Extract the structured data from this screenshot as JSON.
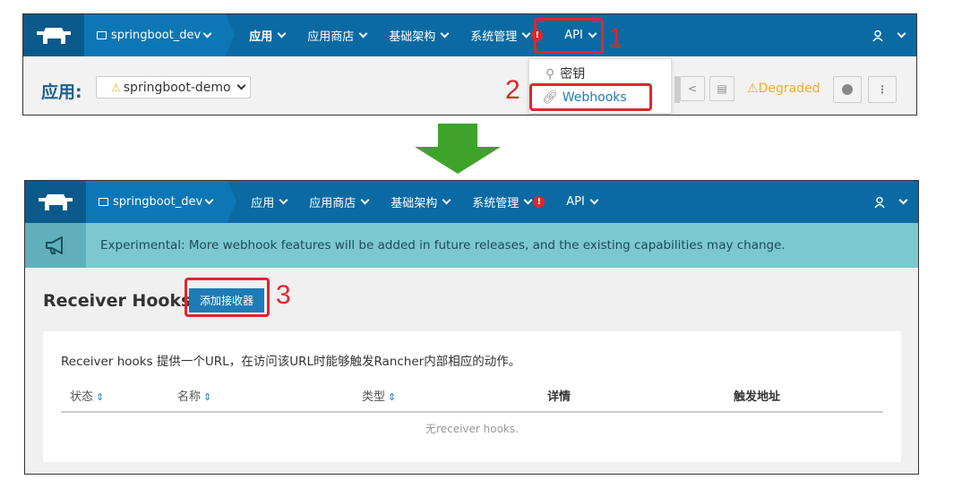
{
  "top": {
    "nav": {
      "project": "springboot_dev",
      "items": [
        "应用",
        "应用商店",
        "基础架构",
        "系统管理",
        "API"
      ],
      "alert": "!"
    },
    "page_label": "应用:",
    "app_select": "springboot-demo",
    "dropdown": {
      "keys": "密钥",
      "webhooks": "Webhooks"
    },
    "status": "Degraded",
    "annotations": [
      "1",
      "2"
    ]
  },
  "bottom": {
    "nav": {
      "project": "springboot_dev",
      "items": [
        "应用",
        "应用商店",
        "基础架构",
        "系统管理",
        "API"
      ],
      "alert": "!"
    },
    "banner": "Experimental: More webhook features will be added in future releases, and the existing capabilities may change.",
    "title": "Receiver Hooks",
    "add_button": "添加接收器",
    "annotation": "3",
    "description": "Receiver hooks 提供一个URL，在访问该URL时能够触发Rancher内部相应的动作。",
    "columns": [
      "状态",
      "名称",
      "类型",
      "详情",
      "触发地址"
    ],
    "empty": "无receiver hooks."
  },
  "colors": {
    "nav": "#0b6aa3",
    "accent": "#e0262b",
    "banner": "#7bc8d1",
    "button": "#1f7ab8"
  },
  "icons": [
    "cow-logo-icon",
    "folder-icon",
    "user-icon",
    "key-icon",
    "link-icon",
    "warning-icon",
    "share-icon",
    "document-icon",
    "stop-icon",
    "more-icon",
    "megaphone-icon",
    "sort-icon",
    "arrow-down-icon"
  ]
}
